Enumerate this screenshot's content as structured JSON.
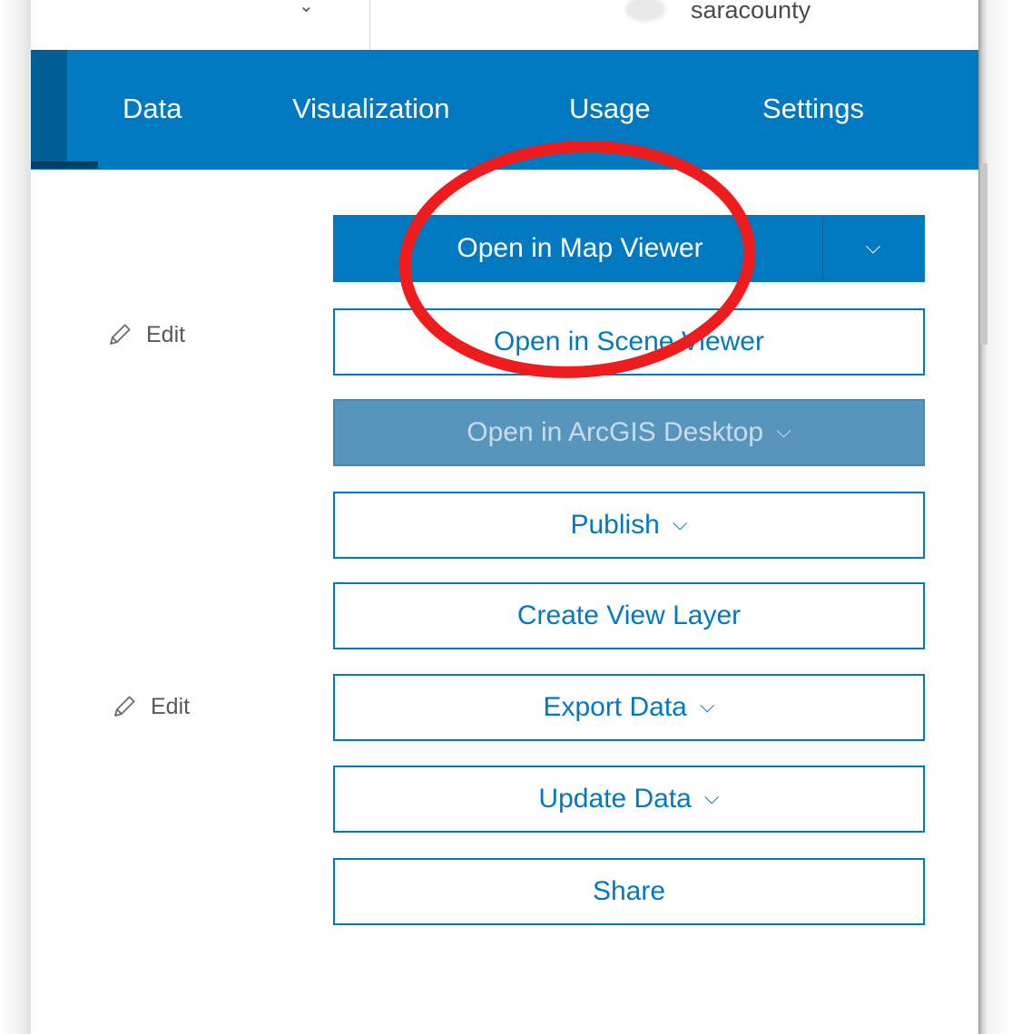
{
  "header": {
    "username": "saracounty"
  },
  "nav": {
    "tabs": [
      {
        "label": "Data"
      },
      {
        "label": "Visualization"
      },
      {
        "label": "Usage"
      },
      {
        "label": "Settings"
      }
    ]
  },
  "edit_links": [
    {
      "label": "Edit",
      "icon": "pencil-icon"
    },
    {
      "label": "Edit",
      "icon": "pencil-icon"
    }
  ],
  "actions": {
    "open_map_viewer": {
      "label": "Open in Map Viewer",
      "dropdown_icon": "chevron-down-icon"
    },
    "open_scene_viewer": {
      "label": "Open in Scene Viewer"
    },
    "open_arcgis_desktop": {
      "label": "Open in ArcGIS Desktop",
      "state": "disabled"
    },
    "publish": {
      "label": "Publish"
    },
    "create_view_layer": {
      "label": "Create View Layer"
    },
    "export_data": {
      "label": "Export Data"
    },
    "update_data": {
      "label": "Update Data"
    },
    "share": {
      "label": "Share"
    }
  },
  "colors": {
    "brand_blue": "#0079c1",
    "disabled_blue": "#5795bd",
    "annotation_red": "#ee1c1c"
  }
}
